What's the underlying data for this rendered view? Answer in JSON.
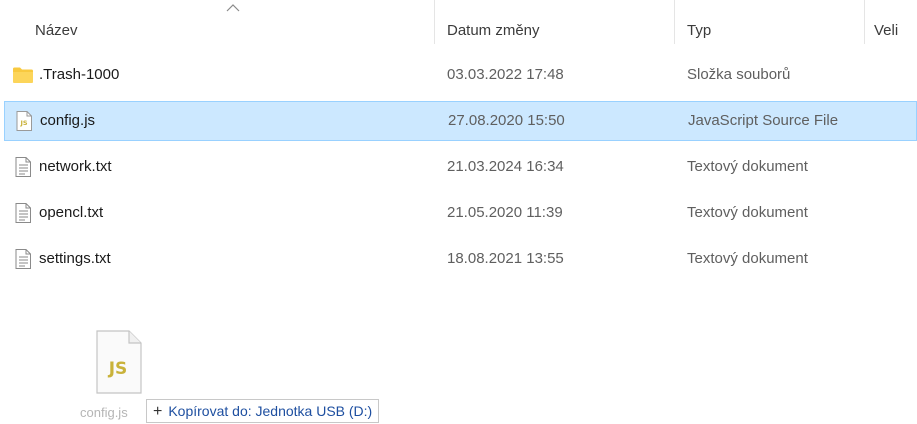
{
  "columns": {
    "name": "Název",
    "date": "Datum změny",
    "type": "Typ",
    "size": "Veli"
  },
  "files": [
    {
      "name": ".Trash-1000",
      "date": "03.03.2022 17:48",
      "type": "Složka souborů",
      "icon": "folder-icon",
      "selected": false
    },
    {
      "name": "config.js",
      "date": "27.08.2020 15:50",
      "type": "JavaScript Source File",
      "icon": "js-file-icon",
      "selected": true
    },
    {
      "name": "network.txt",
      "date": "21.03.2024 16:34",
      "type": "Textový dokument",
      "icon": "text-file-icon",
      "selected": false
    },
    {
      "name": "opencl.txt",
      "date": "21.05.2020 11:39",
      "type": "Textový dokument",
      "icon": "text-file-icon",
      "selected": false
    },
    {
      "name": "settings.txt",
      "date": "18.08.2021 13:55",
      "type": "Textový dokument",
      "icon": "text-file-icon",
      "selected": false
    }
  ],
  "drag": {
    "file_badge": "JS",
    "file_label": "config.js",
    "tooltip_plus": "+",
    "tooltip_text": "Kopírovat do: Jednotka USB (D:)"
  },
  "colors": {
    "selection_bg": "#cce8ff",
    "selection_border": "#99d1ff",
    "folder": "#f8c93f",
    "js_badge": "#c9b23a",
    "tooltip_text": "#1e4fa0"
  }
}
